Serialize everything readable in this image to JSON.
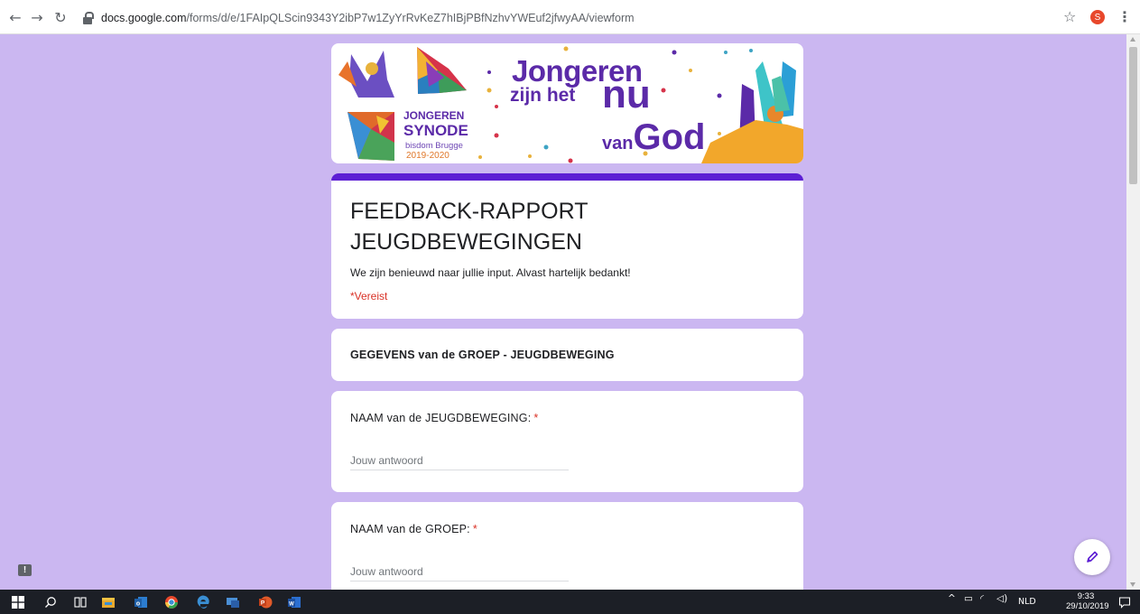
{
  "browser": {
    "url_host": "docs.google.com",
    "url_path": "/forms/d/e/1FAIpQLScin9343Y2ibP7w1ZyYrRvKeZ7hIBjPBfNzhvYWEuf2jfwyAA/viewform",
    "profile_initial": "S"
  },
  "banner": {
    "line1": "Jongeren",
    "line2": "zijn het",
    "nu": "nu",
    "van": "van",
    "god": "God",
    "synode_line1": "JONGEREN",
    "synode_line2": "SYNODE",
    "synode_line3": "bisdom Brugge",
    "synode_line4": "2019-2020"
  },
  "form": {
    "title": "FEEDBACK-RAPPORT JEUGDBEWEGINGEN",
    "description": "We zijn benieuwd naar jullie input. Alvast hartelijk bedankt!",
    "required_note": "*Vereist",
    "section_title": "GEGEVENS van de GROEP - JEUGDBEWEGING",
    "questions": [
      {
        "label": "NAAM van de JEUGDBEWEGING:",
        "required_mark": "*",
        "placeholder": "Jouw antwoord"
      },
      {
        "label": "NAAM van de GROEP:",
        "required_mark": "*",
        "placeholder": "Jouw antwoord"
      }
    ]
  },
  "taskbar": {
    "language": "NLD",
    "time": "9:33",
    "date": "29/10/2019"
  },
  "icons": {
    "back": "back-arrow-icon",
    "forward": "forward-arrow-icon",
    "reload": "reload-icon",
    "lock": "lock-icon",
    "star": "star-icon",
    "menu": "kebab-menu-icon",
    "edit": "pencil-icon",
    "feedback": "feedback-icon"
  },
  "colors": {
    "page_background": "#cbb7f1",
    "accent": "#5d1fd4",
    "required": "#d93025",
    "banner_text": "#5b2aa8"
  }
}
